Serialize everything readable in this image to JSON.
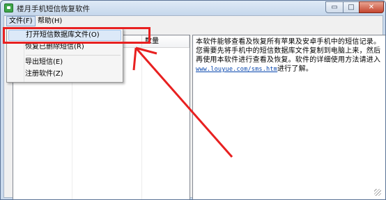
{
  "window": {
    "title": "楼月手机短信恢复软件",
    "controls": {
      "minimize": "▭",
      "maximize": "□",
      "close": "✕"
    }
  },
  "menubar": {
    "file": "文件(F)",
    "help": "帮助(H)"
  },
  "file_menu": [
    "打开短信数据库文件(O)",
    "恢复已删除短信(R)",
    "导出短信(E)",
    "注册软件(Z)"
  ],
  "list": {
    "columns": [
      "",
      "",
      "数量"
    ]
  },
  "info": {
    "text": "本软件能够查看及恢复所有苹果及安卓手机中的短信记录。您需要先将手机中的短信数据库文件复制到电脑上来，然后再使用本软件进行查看及恢复。软件的详细使用方法请进入",
    "link": "www.louyue.com/sms.htm",
    "suffix": "进行了解。"
  },
  "annotation_color": "#e82020"
}
